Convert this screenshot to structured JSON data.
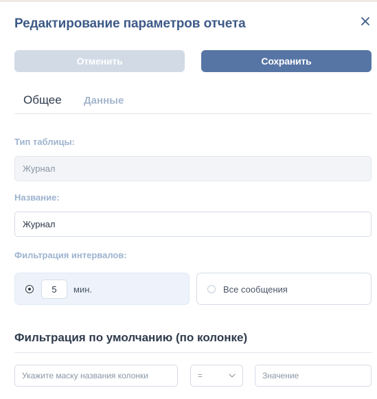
{
  "dialog": {
    "title": "Редактирование параметров отчета"
  },
  "actions": {
    "cancel_label": "Отменить",
    "save_label": "Сохранить"
  },
  "tabs": [
    {
      "label": "Общее",
      "active": true
    },
    {
      "label": "Данные",
      "active": false
    }
  ],
  "form": {
    "table_type": {
      "label": "Тип таблицы:",
      "value": "Журнал",
      "disabled": true
    },
    "name": {
      "label": "Название:",
      "value": "Журнал"
    },
    "interval_filter": {
      "label": "Фильтрация интервалов:",
      "option_minutes": {
        "value": "5",
        "unit": "мин.",
        "selected": true
      },
      "option_all": {
        "label": "Все сообщения",
        "selected": false
      }
    }
  },
  "default_filter": {
    "heading": "Фильтрация по умолчанию (по колонке)",
    "column_mask_placeholder": "Укажите маску названия колонки",
    "operator_value": "=",
    "value_placeholder": "Значение"
  },
  "colors": {
    "title": "#3d5a87",
    "primary_button": "#5675a5",
    "disabled_button": "#d1dae5",
    "label": "#9db3cf",
    "selected_option_bg": "#eef3fb"
  },
  "icons": {
    "close": "close-icon",
    "operator_dropdown": "chevron-down-icon"
  }
}
